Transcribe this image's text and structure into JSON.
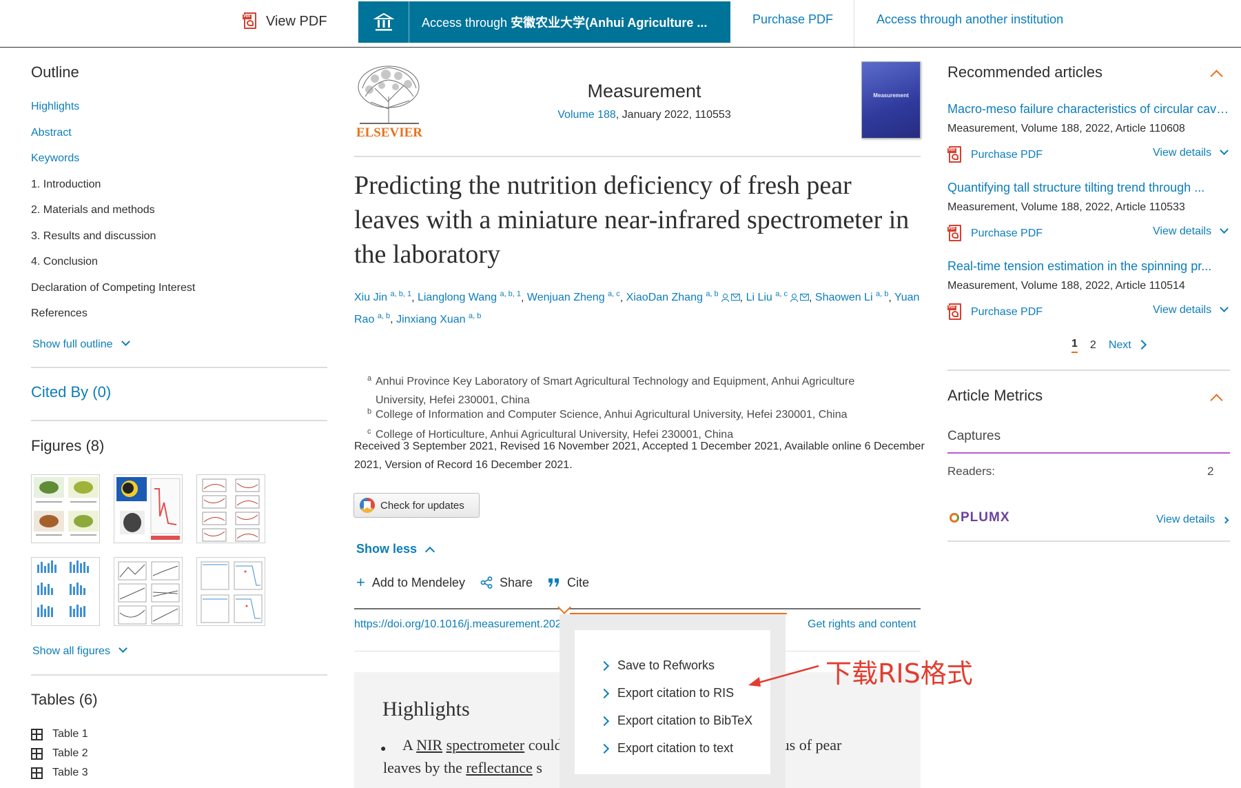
{
  "topbar": {
    "view_pdf": "View PDF",
    "access_prefix": "Access through ",
    "access_institution": "安徽农业大学(Anhui Agriculture ...",
    "purchase_pdf": "Purchase PDF",
    "access_another": "Access through another institution"
  },
  "outline": {
    "title": "Outline",
    "items": [
      "Highlights",
      "Abstract",
      "Keywords",
      "1. Introduction",
      "2. Materials and methods",
      "3. Results and discussion",
      "4. Conclusion",
      "Declaration of Competing Interest",
      "References"
    ],
    "show_full": "Show full outline"
  },
  "cited_by": "Cited By (0)",
  "figures": {
    "title": "Figures (8)",
    "show_all": "Show all figures"
  },
  "tables": {
    "title": "Tables (6)",
    "items": [
      "Table 1",
      "Table 2",
      "Table 3"
    ]
  },
  "journal": {
    "publisher": "ELSEVIER",
    "name": "Measurement",
    "volume": "Volume 188",
    "issue_info": ", January 2022, 110553",
    "cover_title": "Measurement"
  },
  "article": {
    "title": "Predicting the nutrition deficiency of fresh pear leaves with a miniature near-infrared spectrometer in the laboratory",
    "authors": [
      {
        "name": "Xiu Jin",
        "sup": "a, b, 1"
      },
      {
        "name": "Lianglong Wang",
        "sup": "a, b, 1"
      },
      {
        "name": "Wenjuan Zheng",
        "sup": "a, c"
      },
      {
        "name": "XiaoDan Zhang",
        "sup": "a, b"
      },
      {
        "name": "Li Liu",
        "sup": "a, c"
      },
      {
        "name": "Shaowen Li",
        "sup": "a, b"
      },
      {
        "name": "Yuan Rao",
        "sup": "a, b"
      },
      {
        "name": "Jinxiang Xuan",
        "sup": "a, b"
      }
    ],
    "affiliations": [
      {
        "key": "a",
        "text": "Anhui Province Key Laboratory of Smart Agricultural Technology and Equipment, Anhui Agriculture University, Hefei 230001, China"
      },
      {
        "key": "b",
        "text": "College of Information and Computer Science, Anhui Agricultural University, Hefei 230001, China"
      },
      {
        "key": "c",
        "text": "College of Horticulture, Anhui Agricultural University, Hefei 230001, China"
      }
    ],
    "dates": "Received 3 September 2021, Revised 16 November 2021, Accepted 1 December 2021, Available online 6 December 2021, Version of Record 16 December 2021.",
    "check_updates": "Check for updates",
    "show_less": "Show less",
    "actions": {
      "mendeley": "Add to Mendeley",
      "share": "Share",
      "cite": "Cite"
    },
    "doi": "https://doi.org/10.1016/j.measurement.2021.110553",
    "rights": "Get rights and content",
    "highlights_title": "Highlights",
    "highlight_1_a": "A ",
    "highlight_1_nir": "NIR",
    "highlight_1_b": " ",
    "highlight_1_spec": "spectrometer",
    "highlight_1_c": " could",
    "highlight_1_d": "y status of pear",
    "highlight_1_line2a": "leaves by the ",
    "highlight_1_refl": "reflectance",
    "highlight_1_line2b": " s"
  },
  "cite_menu": {
    "options": [
      "Save to Refworks",
      "Export citation to RIS",
      "Export citation to BibTeX",
      "Export citation to text"
    ]
  },
  "annotation": {
    "text": "下载RIS格式",
    "color": "#e23d2f"
  },
  "recommended": {
    "title": "Recommended articles",
    "items": [
      {
        "title": "Macro-meso failure characteristics of circular cavity...",
        "meta": "Measurement, Volume 188, 2022, Article 110608",
        "pdf": "Purchase PDF",
        "details": "View details"
      },
      {
        "title": "Quantifying tall structure tilting trend through ...",
        "meta": "Measurement, Volume 188, 2022, Article 110533",
        "pdf": "Purchase PDF",
        "details": "View details"
      },
      {
        "title": "Real-time tension estimation in the spinning pr...",
        "meta": "Measurement, Volume 188, 2022, Article 110514",
        "pdf": "Purchase PDF",
        "details": "View details"
      }
    ],
    "pager": {
      "current": "1",
      "page2": "2",
      "next": "Next"
    }
  },
  "metrics": {
    "title": "Article Metrics",
    "captures": "Captures",
    "readers_label": "Readers:",
    "readers_value": "2",
    "plumx": "PLUMX",
    "details": "View details"
  },
  "colors": {
    "link": "#0c7dbb",
    "access_bg": "#007398",
    "accent": "#e9711c"
  }
}
